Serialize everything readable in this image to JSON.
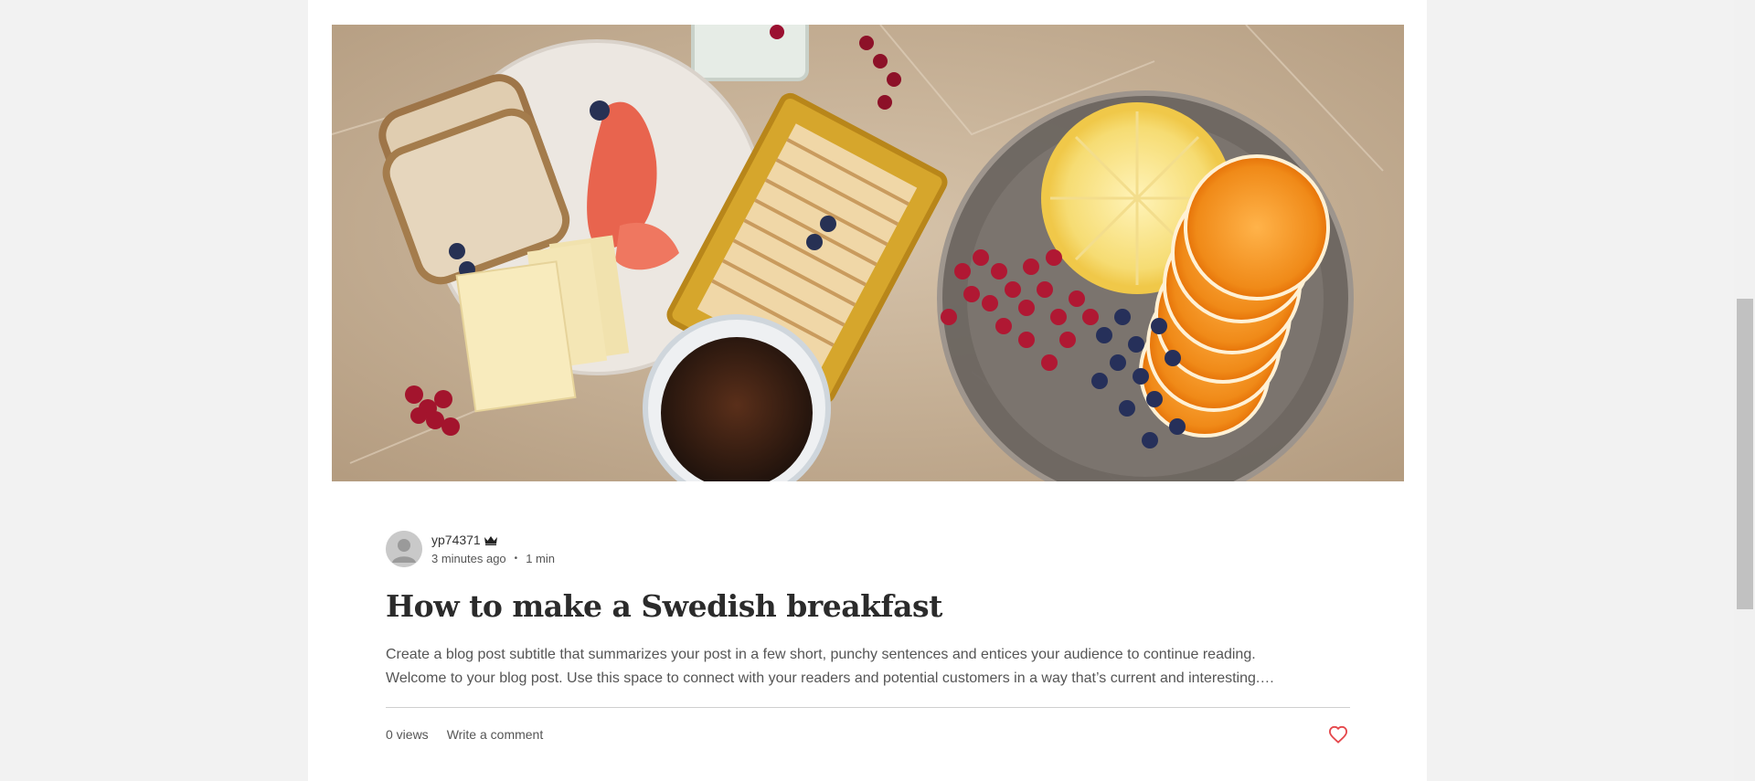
{
  "post": {
    "author": {
      "name": "yp74371",
      "avatar_icon": "user-avatar-icon",
      "badge_icon": "crown-icon"
    },
    "published": "3 minutes ago",
    "read_time": "1 min",
    "meta_separator": "•",
    "title": "How to make a Swedish breakfast",
    "excerpt_line1": "Create a blog post subtitle that summarizes your post in a few short, punchy sentences and entices your audience to continue reading.",
    "excerpt_line2": "Welcome to your blog post. Use this space to connect with your readers and potential customers in a way that’s current and interesting.…",
    "views_label": "0 views",
    "comment_label": "Write a comment",
    "like_icon": "heart-icon"
  },
  "colors": {
    "page_bg": "#f2f2f2",
    "card_bg": "#ffffff",
    "title": "#2b2b2b",
    "body_text": "#555555",
    "heart": "#e5474b"
  }
}
